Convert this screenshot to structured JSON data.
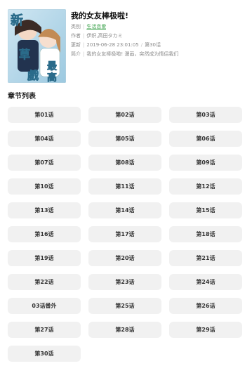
{
  "comic": {
    "title": "我的女友棒极啦!",
    "category_key": "类别",
    "category": "生活恋爱",
    "author_key": "作者",
    "author": "伊织,高田タカミ",
    "update_key": "更新",
    "updated": "2019-06-28 23:01:05",
    "latest": "第30话",
    "intro_key": "简介",
    "intro": "我的女友棒极啦! 漫画，突然成为情侣我们",
    "cover_text": [
      "恋",
      "最",
      "高"
    ]
  },
  "chapters_title": "章节列表",
  "chapters": [
    "第01话",
    "第02话",
    "第03话",
    "第04话",
    "第05话",
    "第06话",
    "第07话",
    "第08话",
    "第09话",
    "第10话",
    "第11话",
    "第12话",
    "第13话",
    "第14话",
    "第15话",
    "第16话",
    "第17话",
    "第18话",
    "第19话",
    "第20话",
    "第21话",
    "第22话",
    "第23话",
    "第24话",
    "03话番外",
    "第25话",
    "第26话",
    "第27话",
    "第28话",
    "第29话",
    "第30话"
  ]
}
